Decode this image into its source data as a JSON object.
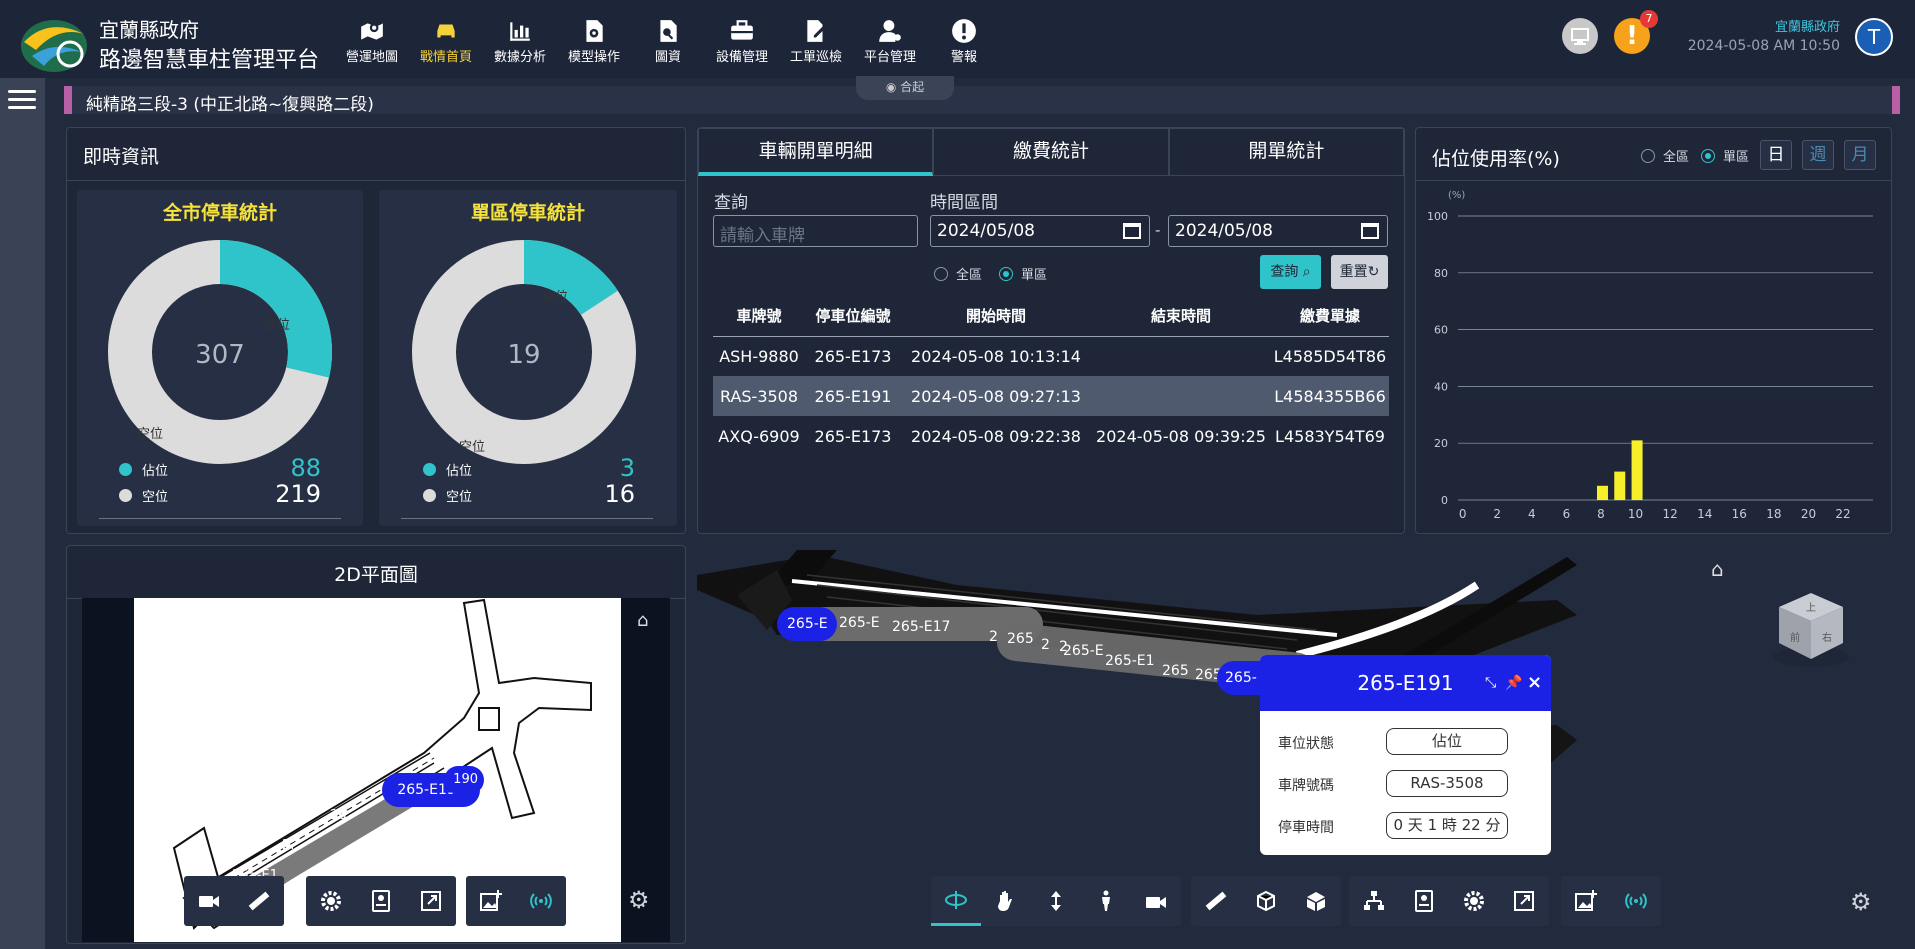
{
  "header": {
    "org_line1": "宜蘭縣政府",
    "org_line2": "路邊智慧車柱管理平台",
    "nav": [
      {
        "label": "營運地圖",
        "icon": "map-marker-icon",
        "active": false
      },
      {
        "label": "戰情首頁",
        "icon": "car-icon",
        "active": true
      },
      {
        "label": "數據分析",
        "icon": "bar-chart-icon",
        "active": false
      },
      {
        "label": "模型操作",
        "icon": "document-gear-icon",
        "active": false
      },
      {
        "label": "圖資",
        "icon": "file-search-icon",
        "active": false
      },
      {
        "label": "設備管理",
        "icon": "toolbox-icon",
        "active": false
      },
      {
        "label": "工單巡檢",
        "icon": "edit-icon",
        "active": false
      },
      {
        "label": "平台管理",
        "icon": "user-gear-icon",
        "active": false
      },
      {
        "label": "警報",
        "icon": "alert-icon",
        "active": false
      }
    ],
    "alert_count": "7",
    "user_org": "宜蘭縣政府",
    "datetime": "2024-05-08 AM 10:50",
    "avatar_initial": "T"
  },
  "collapse_label": "合起",
  "breadcrumb": "純精路三段-3 (中正北路~復興路二段)",
  "realtime": {
    "title": "即時資訊",
    "city": {
      "title": "全市停車統計",
      "total": "307",
      "occupied_label": "佔位",
      "empty_label": "空位",
      "occupied": "88",
      "empty": "219"
    },
    "zone": {
      "title": "單區停車統計",
      "total": "19",
      "occupied_label": "佔位",
      "empty_label": "空位",
      "occupied": "3",
      "empty": "16"
    },
    "colors": {
      "occupied": "#2ec4c9",
      "empty": "#dcdcdc"
    }
  },
  "tickets": {
    "tabs": [
      "車輛開單明細",
      "繳費統計",
      "開單統計"
    ],
    "query_label": "查詢",
    "plate_placeholder": "請輸入車牌",
    "range_label": "時間區間",
    "date_from": "2024/05/08",
    "date_to": "2024/05/08",
    "range_sep": "-",
    "scope_all": "全區",
    "scope_zone": "單區",
    "search_btn": "查詢",
    "reset_btn": "重置",
    "columns": [
      "車牌號",
      "停車位編號",
      "開始時間",
      "結束時間",
      "繳費單據"
    ],
    "rows": [
      [
        "ASH-9880",
        "265-E173",
        "2024-05-08 10:13:14",
        "",
        "L4585D54T86"
      ],
      [
        "RAS-3508",
        "265-E191",
        "2024-05-08 09:27:13",
        "",
        "L4584355B66"
      ],
      [
        "AXQ-6909",
        "265-E173",
        "2024-05-08 09:22:38",
        "2024-05-08 09:39:25",
        "L4583Y54T69"
      ]
    ]
  },
  "usage": {
    "title": "佔位使用率(%)",
    "scope_all": "全區",
    "scope_zone": "單區",
    "period": [
      "日",
      "週",
      "月"
    ]
  },
  "chart_data": {
    "type": "bar",
    "ylabel": "(%)",
    "ylim": [
      0,
      100
    ],
    "yticks": [
      0,
      20,
      40,
      60,
      80,
      100
    ],
    "xticks": [
      0,
      2,
      4,
      6,
      8,
      10,
      12,
      14,
      16,
      18,
      20,
      22
    ],
    "x": [
      8,
      9,
      10
    ],
    "values": [
      5,
      10,
      21
    ],
    "color": "#f7ef2a",
    "grid": true
  },
  "plan2d": {
    "title": "2D平面圖",
    "labels": [
      "265-E191",
      "190",
      "26",
      "2...",
      "265-E1"
    ]
  },
  "model3d": {
    "labels": [
      "265-E",
      "265-E",
      "265-E17",
      "2",
      "265",
      "2",
      "2",
      "265-E",
      "265-E1",
      "265",
      "265",
      "265-"
    ],
    "cube_faces": [
      "上",
      "前",
      "右"
    ]
  },
  "popup": {
    "title": "265-E191",
    "fields": [
      {
        "label": "車位狀態",
        "value": "佔位"
      },
      {
        "label": "車牌號碼",
        "value": "RAS-3508"
      },
      {
        "label": "停車時間",
        "value": "0 天 1 時 22 分"
      }
    ]
  }
}
